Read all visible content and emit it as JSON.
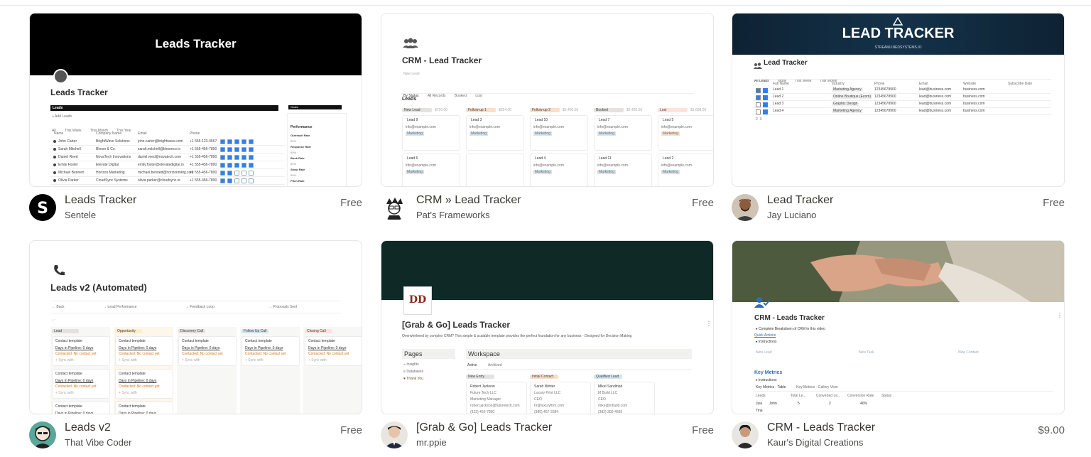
{
  "cards": [
    {
      "name": "Leads Tracker",
      "author": "Sentele",
      "price": "Free",
      "thumb": {
        "banner_title": "Leads Tracker",
        "page_title": "Leads Tracker",
        "db_label": "Leads",
        "side_label": "Goals",
        "add": "+ Add Leads",
        "views": [
          "All",
          "This Week",
          "This Month",
          "This Year"
        ],
        "columns": [
          "Name",
          "Company Name",
          "Email",
          "Phone"
        ],
        "rows": [
          [
            "John Carter",
            "BrightWave Solutions",
            "john.carter@brightwave.com",
            "+1 555-123-4567"
          ],
          [
            "Sarah Mitchell",
            "Bloom & Co.",
            "sarah.mitchell@bloomco.io",
            "+1 555-456-7890"
          ],
          [
            "Daniel Reed",
            "NovaTech Innovations",
            "daniel.reed@novatech.com",
            "+1 555-456-7890"
          ],
          [
            "Emily Foster",
            "Elevate Digital",
            "emily.foster@elevatedigital.io",
            "+1 555-456-7890"
          ],
          [
            "Michael Bennett",
            "Horizon Marketing",
            "michael.bennett@horizonmktg.com",
            "+1 555-456-7890"
          ],
          [
            "Olivia Parker",
            "CloudSync Systems",
            "olivia.parker@cloudsync.io",
            "+1 555-456-7890"
          ]
        ],
        "perf_title": "Performance",
        "perf_items": [
          "Outreach Rate",
          "82%",
          "Response Rate",
          "80%",
          "Book Rate",
          "60%",
          "Show Rate",
          "80%",
          "Pitch Rate"
        ]
      }
    },
    {
      "name": "CRM » Lead Tracker",
      "author": "Pat's Frameworks",
      "price": "Free",
      "thumb": {
        "title": "CRM - Lead Tracker",
        "new_lead": "New Lead",
        "tabs": [
          "By Status",
          "All Records",
          "Booked",
          "Lost"
        ],
        "db": "Leads",
        "columns": [
          {
            "label": "New Lead",
            "amount": "$700.00",
            "color": "#e3e2e0",
            "cards": [
              "Lead 9",
              "Lead 6"
            ]
          },
          {
            "label": "Follow-up 1",
            "amount": "$354.00",
            "color": "#fadec9",
            "cards": [
              "Lead 3",
              ""
            ]
          },
          {
            "label": "Follow-up 2",
            "amount": "$5,400.00",
            "color": "#fadec9",
            "cards": [
              "Lead 10",
              "Lead 4"
            ]
          },
          {
            "label": "Booked",
            "amount": "$2,420.00",
            "color": "#e3e2e0",
            "cards": [
              "Lead 7",
              "Lead 11"
            ]
          },
          {
            "label": "Lost",
            "amount": "$1,098.00",
            "color": "#ffe2dd",
            "cards": [
              "Lead 5",
              "Lead 2"
            ]
          }
        ],
        "email": "info@example.com",
        "tag": "Marketing"
      }
    },
    {
      "name": "Lead Tracker",
      "author": "Jay Luciano",
      "price": "Free",
      "thumb": {
        "banner_title": "LEAD TRACKER",
        "banner_sub": "STREAMLINEDSYSTEMS.IO",
        "page_title": "Lead Tracker",
        "views": [
          "All Leads",
          "Today",
          "This Week",
          "This Month"
        ],
        "columns": [
          "Full Name",
          "Industry",
          "Phone",
          "Email",
          "Website",
          "Subscribe Date"
        ],
        "rows": [
          [
            "Lead 1",
            "Marketing Agency",
            "12345678900",
            "lead@business.com",
            "business.com"
          ],
          [
            "Lead 2",
            "Online Boutique (Ecom)",
            "12345678900",
            "lead@business.com",
            "business.com"
          ],
          [
            "Lead 3",
            "Graphic Design",
            "12345678900",
            "lead@business.com",
            "business.com"
          ],
          [
            "Lead 4",
            "Marketing Agency",
            "12345678900",
            "lead@business.com",
            "business.com"
          ]
        ]
      }
    },
    {
      "name": "Leads v2",
      "author": "That Vibe Coder",
      "price": "Free",
      "thumb": {
        "title": "Leads v2 (Automated)",
        "links": [
          "← Back",
          "→ Lead Performance",
          "→ Feedback Loop",
          "→ Proposals Sent"
        ],
        "columns": [
          {
            "label": "Lead",
            "color": "#e3e2e0"
          },
          {
            "label": "Opportunity",
            "color": "#fdecc8"
          },
          {
            "label": "Discovery Call",
            "color": "#e3e2e0"
          },
          {
            "label": "Follow Up Call",
            "color": "#d3e5ef"
          },
          {
            "label": "Closing Call",
            "color": "#ffe2dd"
          }
        ],
        "card_title": "Contact template",
        "card_line1": "Days in Pipeline: 0 days",
        "card_line2": "Contacted: No contact yet",
        "card_line3": "+ Sync with"
      }
    },
    {
      "name": "[Grab & Go] Leads Tracker",
      "author": "mr.ppie",
      "price": "Free",
      "thumb": {
        "logo": "DD",
        "title": "[Grab & Go] Leads Tracker",
        "desc": "Overwhelmed by complex CRM? This simple & scalable template provides the perfect foundation for any business - Designed for Decision Making",
        "pages_label": "Pages",
        "pages": [
          "Insights",
          "Databases",
          "Thank You"
        ],
        "workspace_label": "Workspace",
        "ws_tabs": [
          "Active",
          "Archived"
        ],
        "columns": [
          {
            "label": "New Entry",
            "name": "Robert Jackson",
            "co": "Future Tech LLC",
            "role": "Marketing Manager",
            "mail": "robert.jackson@futuretech.com",
            "phone": "(323) 456-7890",
            "color": "#e3e2e0"
          },
          {
            "label": "Initial Contact",
            "name": "Sarah Winter",
            "co": "Luxury Print LLC",
            "role": "CEO",
            "mail": "hr@luxuryfirm.com",
            "phone": "(380) 457-2384",
            "color": "#fadec9"
          },
          {
            "label": "Qualified Lead",
            "name": "Mikel Sandman",
            "co": "M Build LLC",
            "role": "CEO",
            "mail": "mike@mbuild.com",
            "phone": "(382) 300-4665",
            "color": "#d3e5ef"
          }
        ]
      }
    },
    {
      "name": "CRM - Leads Tracker",
      "author": "Kaur's Digital Creations",
      "price": "$9.00",
      "thumb": {
        "title": "CRM - Leads Tracker",
        "line1": "Complete Breakdown of CRM in this video",
        "line2": "Quick Actions",
        "line3": "Instructions",
        "actions": [
          "New Lead",
          "New Task",
          "New Contact"
        ],
        "metrics_title": "Key Metrics",
        "metrics_sub": "Instructions",
        "metrics_tabs": [
          "Key Metrics - Table",
          "Key Metrics - Gallery View"
        ],
        "metrics_cols": [
          "Leads",
          "Total Le...",
          "Converted Le...",
          "Conversion Rate",
          "Status"
        ],
        "metrics_row": [
          "Jiya",
          "John",
          "5",
          "2",
          "40%"
        ],
        "metrics_row2": "Tina"
      }
    }
  ]
}
